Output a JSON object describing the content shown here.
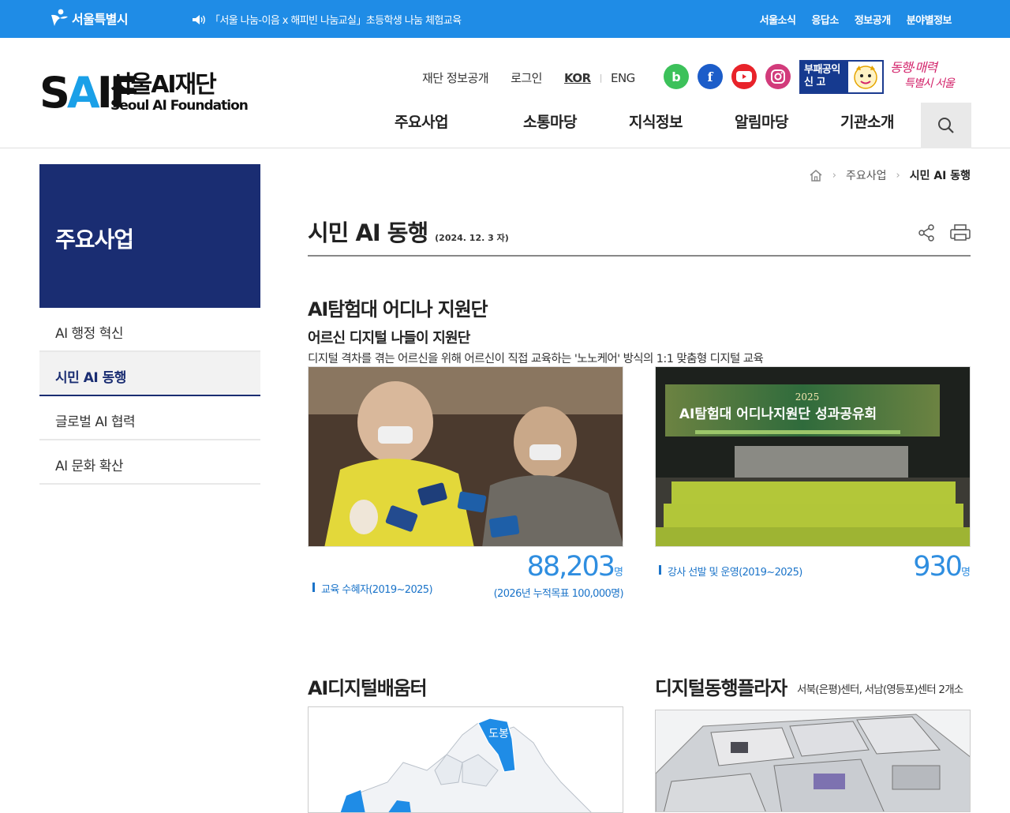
{
  "topbar": {
    "seoul_logo": "서울특별시",
    "notice": "「서울 나눔-이음 x 해피빈 나눔교실」초등학생 나눔 체험교육",
    "links": [
      "서울소식",
      "응답소",
      "정보공개",
      "분야별정보"
    ],
    "bg_color": "#1f8ce6"
  },
  "header": {
    "logo_mark": "SAIF",
    "logo_ko": "서울AI재단",
    "logo_en": "Seoul AI Foundation",
    "util": {
      "disclosure": "재단 정보공개",
      "login": "로그인",
      "kor": "KOR",
      "eng": "ENG"
    },
    "sns": [
      "b",
      "f"
    ],
    "report": "부패공익 신 고",
    "slogan": [
      "동행·매력",
      "특별시 서울"
    ],
    "gnb": [
      "주요사업",
      "소통마당",
      "지식정보",
      "알림마당",
      "기관소개"
    ]
  },
  "lnb": {
    "title": "주요사업",
    "items": [
      "AI 행정 혁신",
      "시민 AI 동행",
      "글로벌 AI 협력",
      "AI 문화 확산"
    ],
    "active_index": 1,
    "title_color": "#1a2d72"
  },
  "breadcrumb": [
    "주요사업",
    "시민 AI 동행"
  ],
  "page": {
    "title": "시민 AI 동행",
    "date": "(2024. 12. 3 자)"
  },
  "section1": {
    "title": "AI탐험대 어디나 지원단",
    "subtitle": "어르신 디지털 나들이 지원단",
    "desc": "디지털 격차를 겪는 어르신을 위해 어르신이 직접 교육하는 '노노케어' 방식의 1:1 맞춤형 디지털 교육",
    "photo2_banner_year": "2025",
    "photo2_banner": "AI탐험대 어디나지원단 성과공유회",
    "stats": [
      {
        "label": "교육 수혜자(2019~2025)",
        "value": "88,203",
        "unit": "명",
        "sub": "(2026년 누적목표 100,000명)"
      },
      {
        "label": "강사 선발 및 운영(2019~2025)",
        "value": "930",
        "unit": "명"
      }
    ],
    "stat_color": "#2f8ee0"
  },
  "section2": {
    "left_title": "AI디지털배움터",
    "right_title": "디지털동행플라자",
    "right_note": "서북(은평)센터, 서남(영등포)센터 2개소",
    "map_label": "도봉"
  }
}
